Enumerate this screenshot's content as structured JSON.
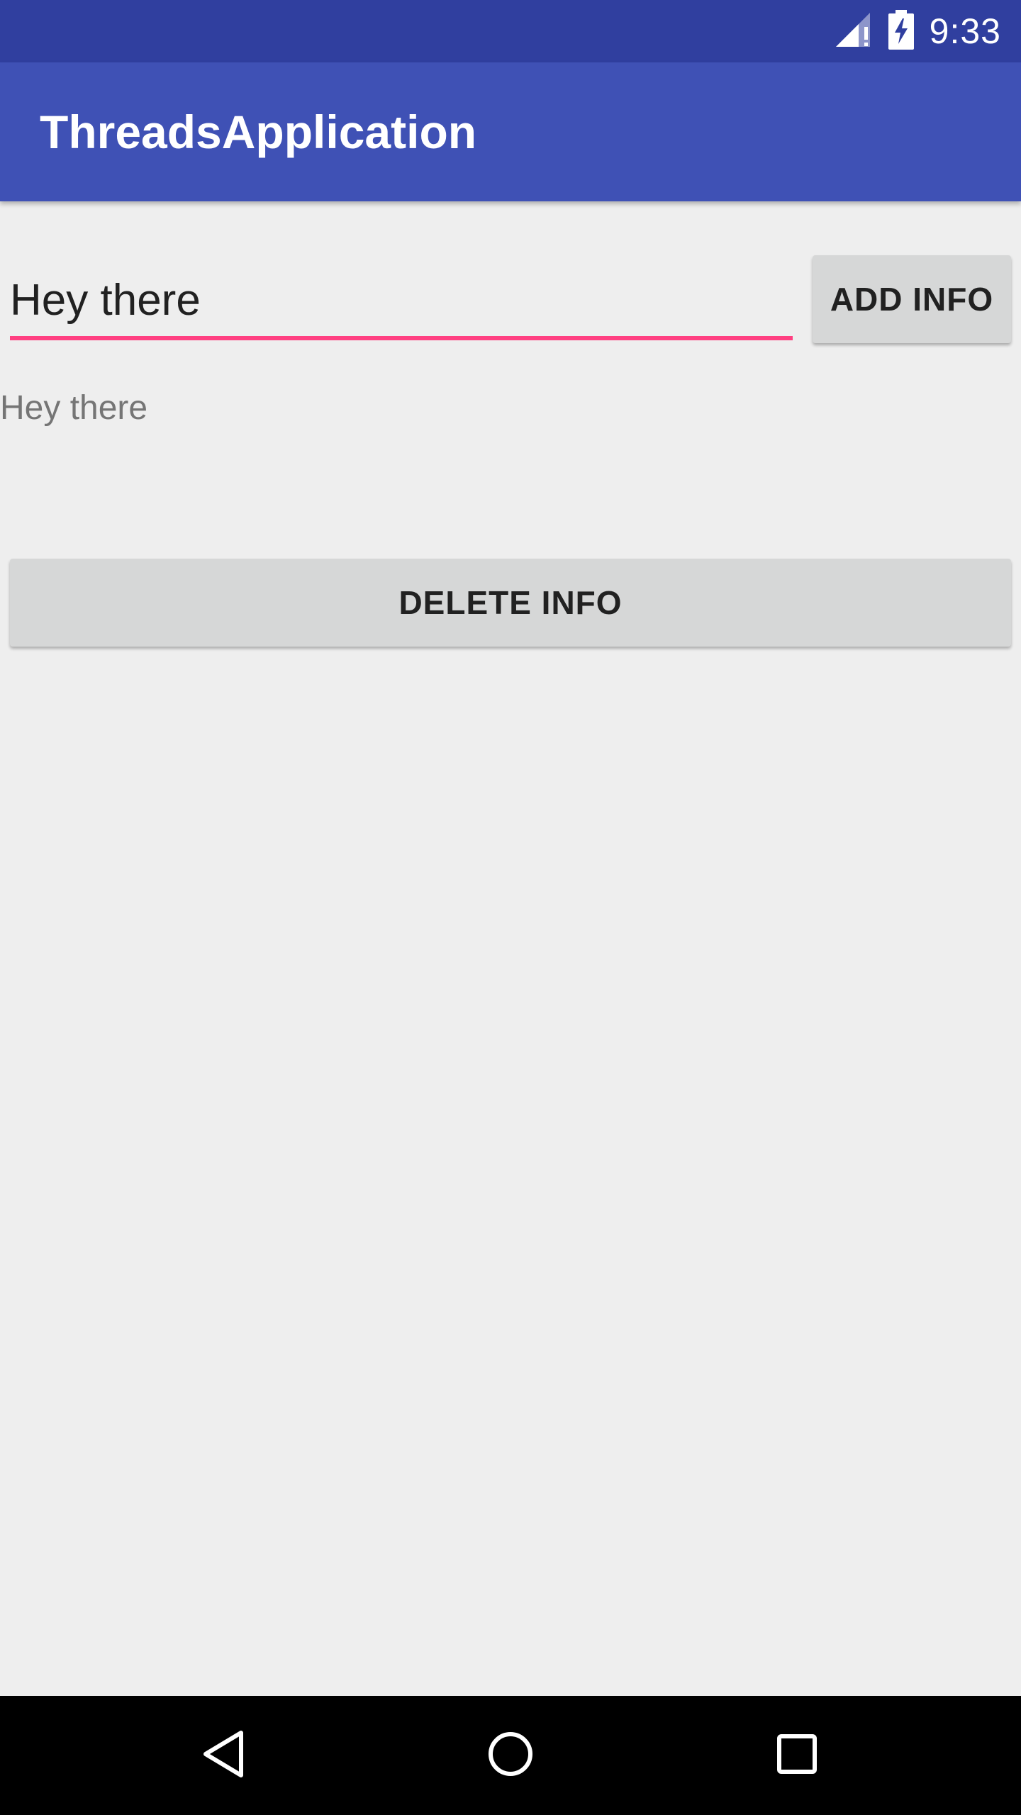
{
  "status_bar": {
    "time": "9:33",
    "icons": [
      "signal-no-connection-icon",
      "battery-charging-icon"
    ],
    "background": "#303f9f"
  },
  "app_bar": {
    "title": "ThreadsApplication",
    "background": "#3f51b5"
  },
  "form": {
    "input_value": "Hey there",
    "add_button_label": "ADD INFO",
    "accent_color": "#ff4081"
  },
  "info": {
    "text": "Hey there"
  },
  "actions": {
    "delete_button_label": "DELETE INFO"
  },
  "nav_bar": {
    "icons": [
      "back-icon",
      "home-icon",
      "recents-icon"
    ]
  }
}
